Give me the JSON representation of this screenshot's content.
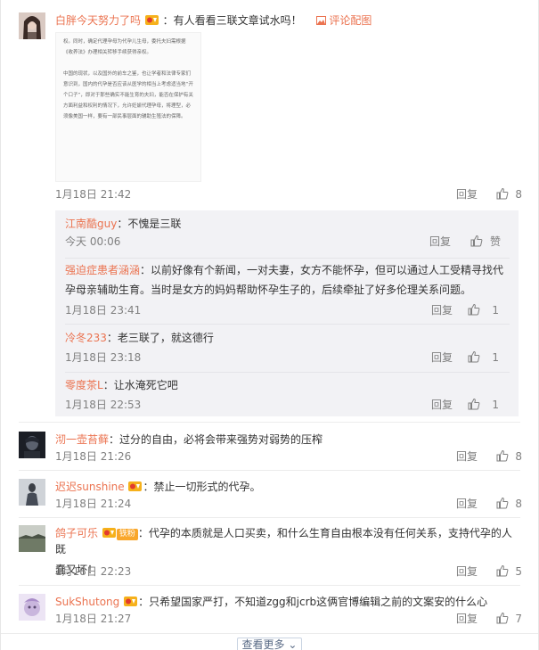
{
  "comments": [
    {
      "user": "白胖今天努力了吗",
      "text": "：有人看看三联文章试水吗！",
      "extra_link": "评论配图",
      "image_paragraphs": [
        "权。同时，确定代理孕母为代孕儿生母，委托夫妇需根据《收养法》办理相关转移手续获得亲权。",
        "中国的现状，以及国外的前车之鉴，也让学者和法律专家们意识到，国内的代孕是否应该从医学的相当上考虑适当地“开个口子”，即对于那些确实不能生育的夫妇，能否在保护有关方面利益和权利的情况下，允许妊娠代理孕母，将理型，必须像美国一样，要有一部民事层面的辅助生殖法的保障。"
      ],
      "time": "1月18日 21:42",
      "reply_label": "回复",
      "likes": "8"
    },
    {
      "user": "沏一壶苔藓",
      "text": "：过分的自由，必将会带来强势对弱势的压榨",
      "time": "1月18日 21:26",
      "reply_label": "回复",
      "likes": "8"
    },
    {
      "user": "迟迟sunshine",
      "text": "：禁止一切形式的代孕。",
      "time": "1月18日 21:24",
      "reply_label": "回复",
      "likes": "8"
    },
    {
      "user": "鸽子可乐",
      "badge": "铁粉",
      "text_line1": "：代孕的本质就是人口买卖，和什么生育自由根本没有任何关系，支持代孕的人既",
      "text_line2": "蠢又坏！",
      "time": "1月18日 22:23",
      "reply_label": "回复",
      "likes": "5"
    },
    {
      "user": "SukShutong",
      "text": "：只希望国家严打，不知道zgg和jcrb这俩官博编辑之前的文案安的什么心",
      "time": "1月18日 21:27",
      "reply_label": "回复",
      "likes": "7"
    }
  ],
  "replies": [
    {
      "user": "江南酷guy",
      "text": "：不愧是三联",
      "time": "今天 00:06",
      "reply_label": "回复",
      "likes": "赞"
    },
    {
      "user": "强迫症患者涵涵",
      "text_line1": "：以前好像有个新闻，一对夫妻，女方不能怀孕，但可以通过人工受精寻找代",
      "text_line2": "孕母亲辅助生育。当时是女方的妈妈帮助怀孕生子的，后续牵扯了好多伦理关系问题。",
      "time": "1月18日 23:41",
      "reply_label": "回复",
      "likes": "1"
    },
    {
      "user": "冷冬233",
      "text": "：老三联了，就这德行",
      "time": "1月18日 23:18",
      "reply_label": "回复",
      "likes": "1"
    },
    {
      "user": "零度茶L",
      "text": "：让水淹死它吧",
      "time": "1月18日 22:53",
      "reply_label": "回复",
      "likes": "1"
    }
  ],
  "more_label": "查看更多",
  "colors": {
    "username": "#eb7350",
    "meta": "#808080",
    "reply_bg": "#f2f2f5"
  }
}
